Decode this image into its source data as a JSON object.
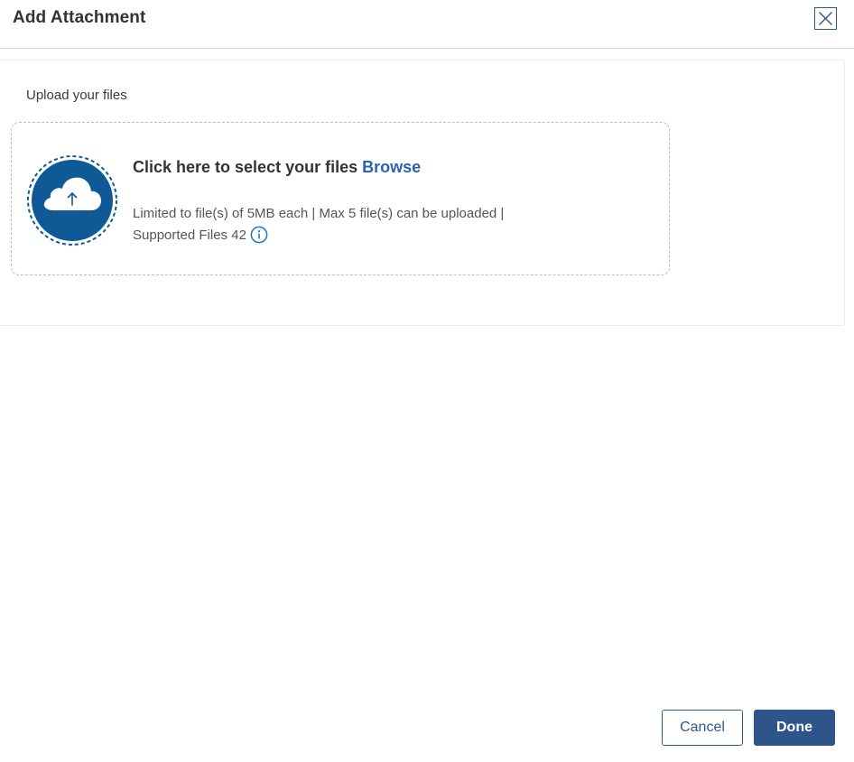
{
  "dialog": {
    "title": "Add Attachment",
    "close_icon": "close-icon"
  },
  "upload": {
    "label": "Upload your files",
    "headline": "Click here to select your files",
    "browse_label": "Browse",
    "limits_line1": "Limited to file(s) of 5MB each | Max 5 file(s) can be uploaded |",
    "limits_line2": "Supported Files 42",
    "upload_icon": "cloud-upload-icon",
    "info_icon": "info-icon"
  },
  "footer": {
    "cancel_label": "Cancel",
    "done_label": "Done"
  },
  "colors": {
    "primary": "#2e548c",
    "badge": "#0f5a96",
    "link": "#2a63b3",
    "info": "#1a7ac8"
  }
}
